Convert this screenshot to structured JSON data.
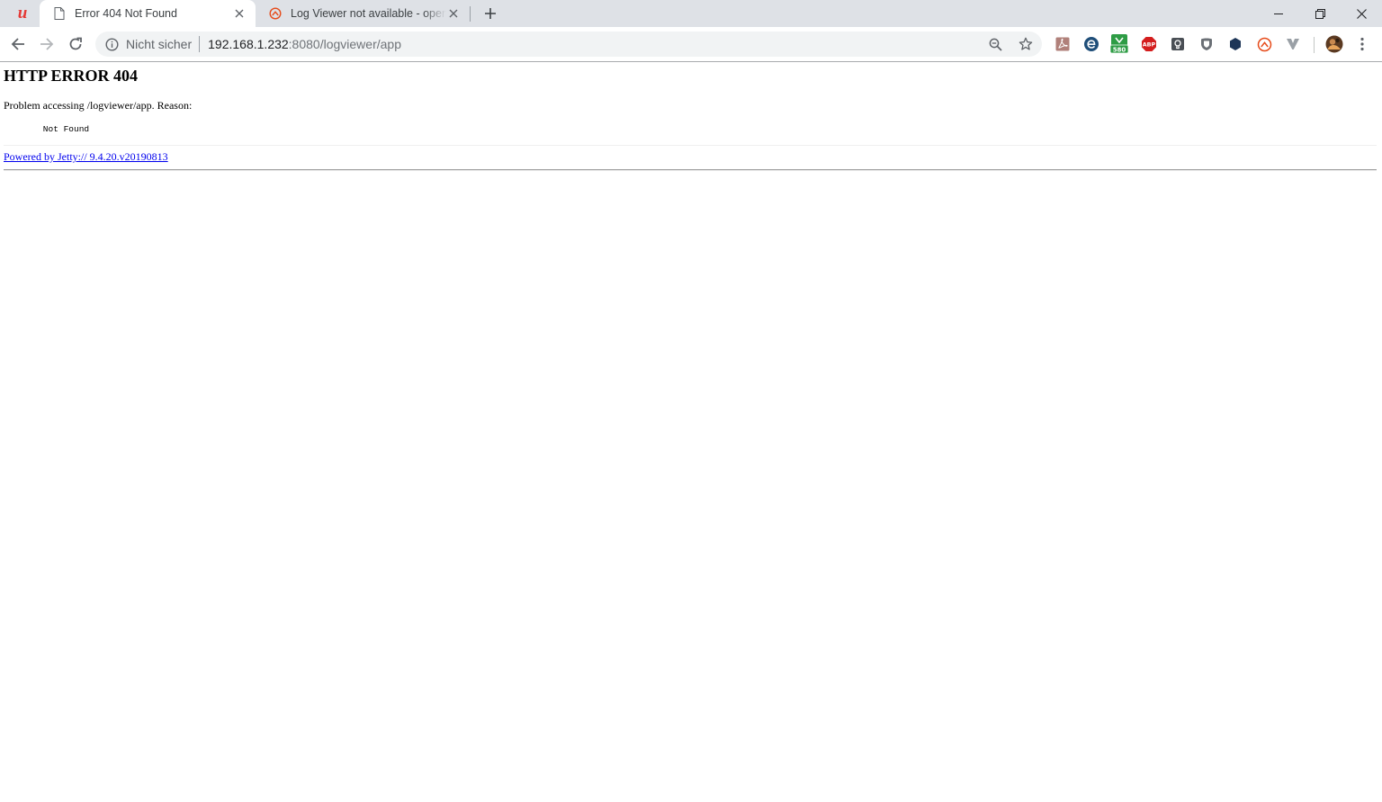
{
  "browser": {
    "tabs": [
      {
        "title": "Error 404 Not Found",
        "active": true,
        "favicon": "document-icon"
      },
      {
        "title": "Log Viewer not available - openHAB",
        "active": false,
        "favicon": "openhab-icon"
      }
    ],
    "address_bar": {
      "security_label": "Nicht sicher",
      "url_host": "192.168.1.232",
      "url_rest": ":8080/logviewer/app"
    },
    "extensions": [
      {
        "name": "acrobat-extension-icon",
        "badge": ""
      },
      {
        "name": "edge-e-extension-icon",
        "badge": ""
      },
      {
        "name": "counter-extension-icon",
        "badge": "580"
      },
      {
        "name": "adblock-plus-icon",
        "badge": "ABP"
      },
      {
        "name": "lightbulb-extension-icon",
        "badge": ""
      },
      {
        "name": "shield-extension-icon",
        "badge": ""
      },
      {
        "name": "hexagon-extension-icon",
        "badge": ""
      },
      {
        "name": "openhab-extension-icon",
        "badge": ""
      },
      {
        "name": "vivaldi-extension-icon",
        "badge": ""
      }
    ],
    "colors": {
      "tab_strip": "#dee1e6",
      "link": "#0000ee",
      "logo": "#e53935"
    }
  },
  "page": {
    "heading": "HTTP ERROR 404",
    "reason_line": "Problem accessing /logviewer/app. Reason:",
    "reason_detail": "    Not Found",
    "footer_link": "Powered by Jetty:// 9.4.20.v20190813"
  }
}
